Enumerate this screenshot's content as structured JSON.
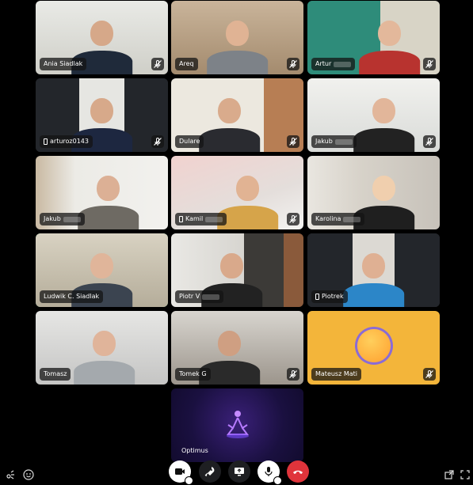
{
  "participants": [
    {
      "name": "Ania Siadlak",
      "muted": true,
      "mobile": false
    },
    {
      "name": "Areq",
      "muted": true,
      "mobile": false
    },
    {
      "name": "Artur",
      "muted": true,
      "mobile": false
    },
    {
      "name": "arturoz0143",
      "muted": true,
      "mobile": true
    },
    {
      "name": "Dulare",
      "muted": true,
      "mobile": false
    },
    {
      "name": "Jakub",
      "muted": true,
      "mobile": false
    },
    {
      "name": "Jakub",
      "muted": false,
      "mobile": false
    },
    {
      "name": "Kamil",
      "muted": true,
      "mobile": true
    },
    {
      "name": "Karolina",
      "muted": false,
      "mobile": false
    },
    {
      "name": "Ludwik C. Siadlak",
      "muted": false,
      "mobile": false,
      "speaking": true
    },
    {
      "name": "Piotr V",
      "muted": false,
      "mobile": false
    },
    {
      "name": "Piotrek",
      "muted": false,
      "mobile": true
    },
    {
      "name": "Tomasz",
      "muted": false,
      "mobile": false
    },
    {
      "name": "Tomek G",
      "muted": true,
      "mobile": false
    },
    {
      "name": "Mateusz Mati",
      "muted": true,
      "mobile": false
    },
    {
      "name": "Optimus",
      "muted": false,
      "mobile": false
    }
  ],
  "controls": [
    "camera-toggle",
    "activities",
    "screen-share",
    "microphone-toggle",
    "leave-call"
  ],
  "colors": {
    "speaking": "#43b581",
    "leave": "#e0343b",
    "avatar_tile": "#f3b53a",
    "optimus_tile": "#1a1040"
  }
}
